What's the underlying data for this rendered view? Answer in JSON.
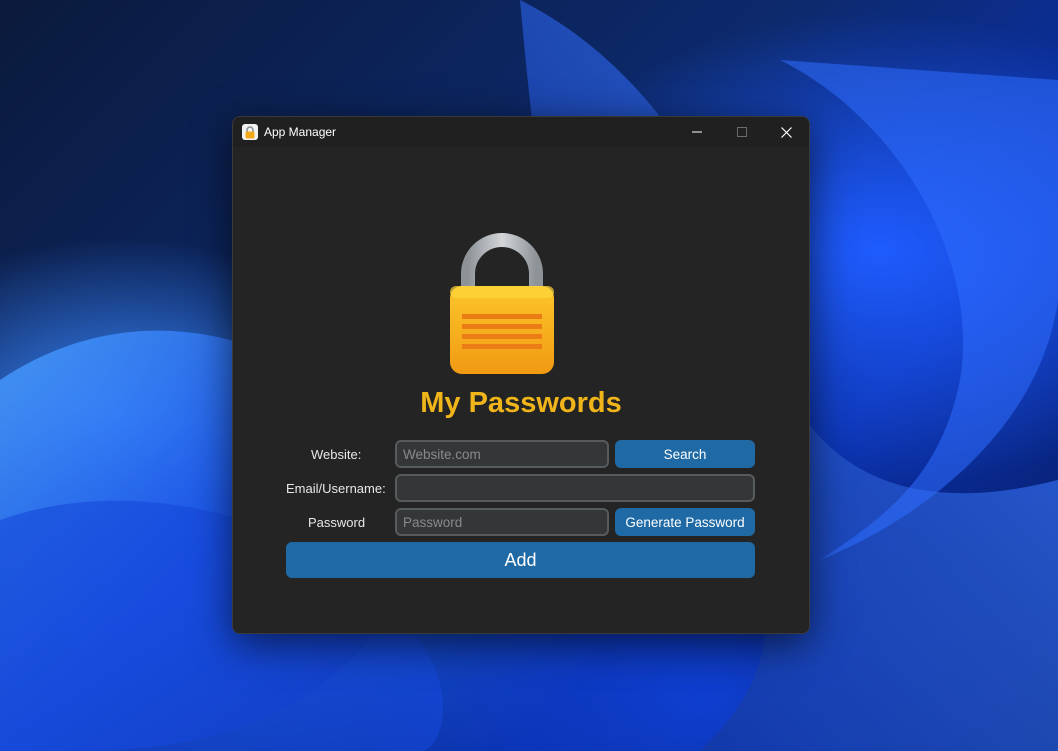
{
  "window": {
    "title": "App Manager",
    "icon": "lock-icon"
  },
  "titlebar_controls": {
    "minimize_icon": "minimize-icon",
    "maximize_icon": "maximize-icon",
    "close_icon": "close-icon"
  },
  "main": {
    "logo_icon": "padlock-icon",
    "heading": "My Passwords",
    "website_label": "Website:",
    "website_placeholder": "Website.com",
    "search_button": "Search",
    "email_label": "Email/Username:",
    "email_value": "",
    "password_label": "Password",
    "password_placeholder": "Password",
    "generate_button": "Generate Password",
    "add_button": "Add"
  },
  "colors": {
    "accent_button": "#1f6aa5",
    "heading": "#f0b51a",
    "window_bg": "#242424",
    "field_bg": "#343638"
  }
}
